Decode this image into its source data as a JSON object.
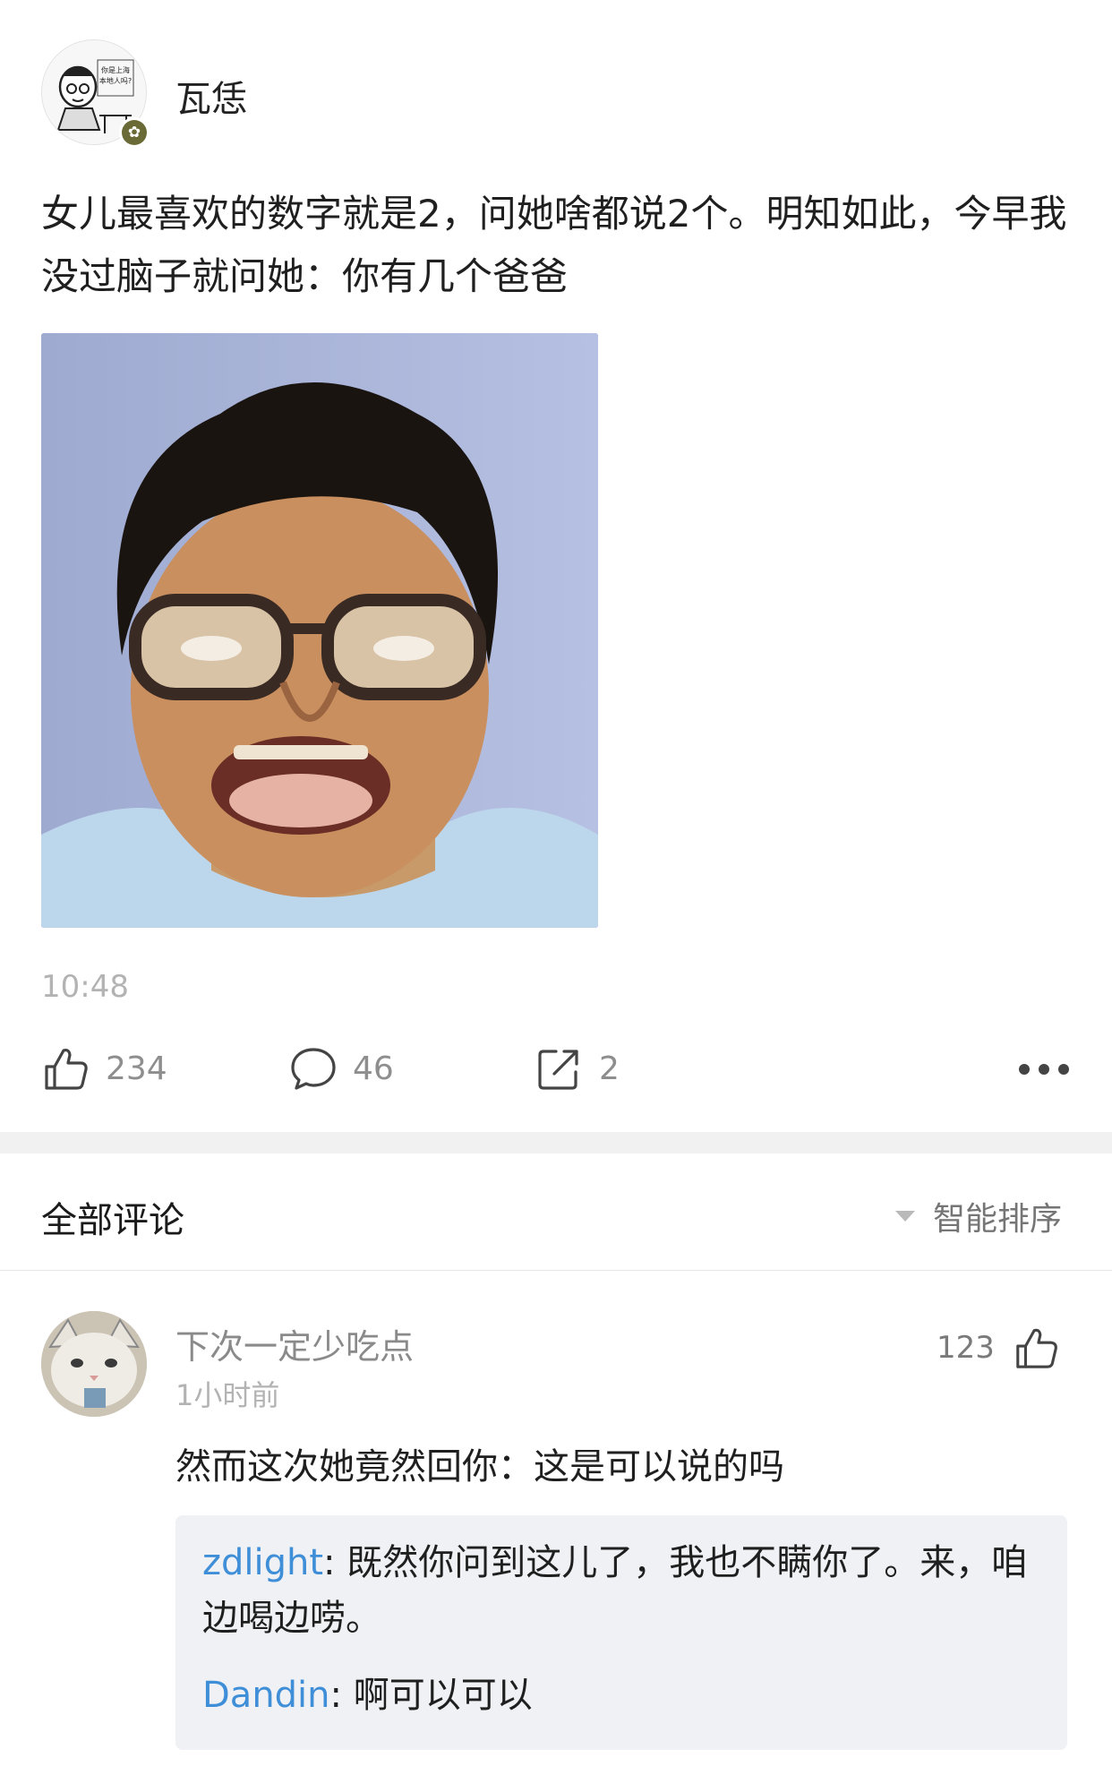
{
  "post": {
    "author": {
      "name": "瓦恁",
      "avatar_caption": "你是上海本地人吗?",
      "avatar_icon": "cartoon-boy-avatar",
      "badge_icon": "verified-flower-icon"
    },
    "text": "女儿最喜欢的数字就是2，问她啥都说2个。明知如此，今早我没过脑子就问她：你有几个爸爸",
    "image_icon": "meme-face-image",
    "time": "10:48",
    "actions": {
      "like_count": "234",
      "comment_count": "46",
      "share_count": "2",
      "more_icon": "more-dots-icon"
    }
  },
  "comments": {
    "title": "全部评论",
    "sort_label": "智能排序",
    "items": [
      {
        "user": "下次一定少吃点",
        "time": "1小时前",
        "likes": "123",
        "text": "然而这次她竟然回你：这是可以说的吗",
        "replies": [
          {
            "user": "zdlight",
            "sep": ": ",
            "text": "既然你问到这儿了，我也不瞒你了。来，咱边喝边唠。"
          },
          {
            "user": "Dandin",
            "sep": ": ",
            "text": "啊可以可以"
          }
        ]
      }
    ]
  },
  "colors": {
    "link": "#3f8ed8",
    "muted": "#8e8e8e",
    "reply_bg": "#f0f1f4",
    "gap": "#f1f1f2"
  }
}
